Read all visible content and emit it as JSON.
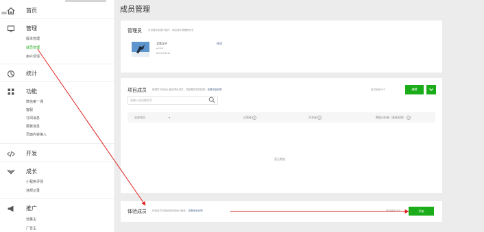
{
  "sidebar": {
    "home": {
      "icon": "home-icon",
      "label": "首页"
    },
    "manage": {
      "icon": "monitor-icon",
      "label": "管理",
      "items": [
        {
          "label": "版本管理"
        },
        {
          "label": "成员管理",
          "active": true
        },
        {
          "label": "用户反馈"
        }
      ]
    },
    "stats": {
      "icon": "stats-icon",
      "label": "统计"
    },
    "features": {
      "icon": "features-icon",
      "label": "功能",
      "items": [
        {
          "label": "微信第一课"
        },
        {
          "label": "客服"
        },
        {
          "label": "订阅消息"
        },
        {
          "label": "模板消息"
        },
        {
          "label": "页面内容接入"
        }
      ]
    },
    "develop": {
      "icon": "code-icon",
      "label": "开发"
    },
    "growth": {
      "icon": "growth-icon",
      "label": "成长",
      "items": [
        {
          "label": "小程序评测"
        },
        {
          "label": "违规记录"
        }
      ]
    },
    "promotion": {
      "icon": "promotion-icon",
      "label": "推广",
      "items": [
        {
          "label": "流量主"
        },
        {
          "label": "广告主"
        }
      ]
    }
  },
  "page_title": "成员管理",
  "admin_card": {
    "title": "管理员",
    "desc": "可设置风险操作保护、风险操作提醒等安全",
    "name": "北农汉子",
    "id": "r*****l",
    "date": "2019-05-11",
    "modify": "修改"
  },
  "project_card": {
    "title": "项目成员",
    "desc": "管理员可添加小程序项目成员，并配置成员的权限。",
    "desc_link": "查看详细说明",
    "limit": "还可添加15个",
    "edit_button": "编辑",
    "search_placeholder": "请输入成员微信号",
    "columns": [
      "全部成员",
      "▾",
      "运营者",
      "开发者",
      "数据分析者（基础权限）"
    ],
    "empty": "暂无数据"
  },
  "tester_card": {
    "title": "体验成员",
    "desc": "体验成员只能使用体验版小程序。",
    "desc_link": "查看体验说明",
    "limit": "还可添加15个",
    "add_button": "添加"
  },
  "colors": {
    "accent": "#1aad19",
    "link": "#576b95",
    "annotation": "#e02020"
  }
}
